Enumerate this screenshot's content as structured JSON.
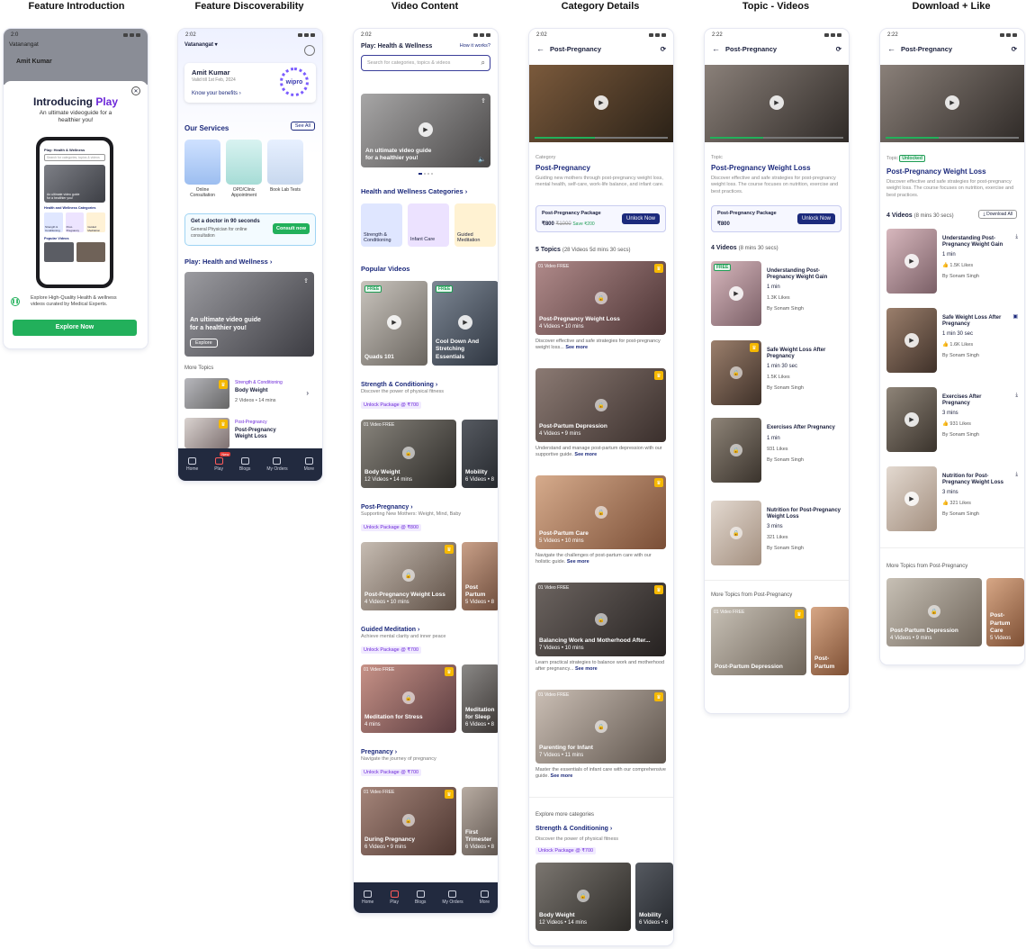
{
  "columns": [
    "Feature Introduction",
    "Feature Discoverability",
    "Video Content",
    "Category Details",
    "Topic - Videos",
    "Download + Like"
  ],
  "s1": {
    "time": "2:0",
    "location": "Vatanangat",
    "user": "Amit Kumar",
    "intro": "Introducing",
    "brand": "Play",
    "sub": "An ultimate videoguide for a healthier you!",
    "mock_header": "Play: Health & Wellness",
    "mock_search": "Search for categories, topics & videos",
    "mock_banner": "An ultimate video guide for a healthier you!",
    "mock_cat_title": "Health and Wellness Categories",
    "mock_cats": [
      "Strength & Conditioning",
      "Post-Pregnancy",
      "Guided Meditation"
    ],
    "mock_popular": "Popular Videos",
    "explore_text": "Explore High-Quality Health & wellness videos curated by Medical Experts.",
    "cta": "Explore Now"
  },
  "s2": {
    "time": "2:02",
    "location": "Vatanangat",
    "user": "Amit Kumar",
    "valid": "Valid till 1st Feb, 2024",
    "benefits": "Know your benefits",
    "partner": "wipro",
    "services_title": "Our Services",
    "see_all": "See All",
    "services": [
      "Online Consultation",
      "OPD/Clinic Appointment",
      "Book Lab Tests"
    ],
    "doctor_title": "Get a doctor in 90 seconds",
    "doctor_sub": "General Physician for online consultation",
    "consult": "Consult now",
    "play_title": "Play: Health and Wellness",
    "banner": "An ultimate video guide for a healthier you!",
    "explore": "Explore",
    "more_topics": "More Topics",
    "topics": [
      {
        "cat": "Strength & Conditioning",
        "name": "Body Weight",
        "meta": "2 Videos • 14 mins"
      },
      {
        "cat": "Post-Pregnancy",
        "name": "Post-Pregnancy Weight Loss",
        "meta": ""
      }
    ],
    "nav": [
      "Home",
      "Play",
      "Blogs",
      "My Orders",
      "More"
    ],
    "new": "New"
  },
  "s3": {
    "time": "2:02",
    "title": "Play: Health & Wellness",
    "how": "How it works?",
    "search": "Search for categories, topics & videos",
    "banner": "An ultimate video guide for a healthier you!",
    "cat_title": "Health and Wellness Categories",
    "cats": [
      "Strength & Conditioning",
      "Infant Care",
      "Guided Meditation"
    ],
    "popular": "Popular Videos",
    "free": "FREE",
    "popular_videos": [
      "Quads 101",
      "Cool Down And Stretching Essentials"
    ],
    "sections": [
      {
        "title": "Strength & Conditioning",
        "desc": "Discover the power of physical fitness",
        "pill": "Unlock Package @ ₹700",
        "cards": [
          {
            "name": "Body Weight",
            "meta": "12 Videos • 14 mins"
          },
          {
            "name": "Mobility",
            "meta": "6 Videos • 8"
          }
        ]
      },
      {
        "title": "Post-Pregnancy",
        "desc": "Supporting New Mothers: Weight, Mind, Baby",
        "pill": "Unlock Package @ ₹800",
        "cards": [
          {
            "name": "Post-Pregnancy Weight Loss",
            "meta": "4 Videos • 10 mins"
          },
          {
            "name": "Post Partum",
            "meta": "5 Videos • 8"
          }
        ]
      },
      {
        "title": "Guided Meditation",
        "desc": "Achieve mental clarity and inner peace",
        "pill": "Unlock Package @ ₹700",
        "cards": [
          {
            "name": "Meditation for Stress",
            "meta": "4 mins"
          },
          {
            "name": "Meditation for Sleep",
            "meta": "6 Videos • 8"
          }
        ]
      },
      {
        "title": "Pregnancy",
        "desc": "Navigate the journey of pregnancy",
        "pill": "Unlock Package @ ₹700",
        "cards": [
          {
            "name": "During Pregnancy",
            "meta": "6 Videos • 9 mins"
          },
          {
            "name": "First Trimester",
            "meta": "6 Videos • 8"
          }
        ]
      }
    ],
    "video_free": "01 Video FREE",
    "nav": [
      "Home",
      "Play",
      "Blogs",
      "My Orders",
      "More"
    ]
  },
  "s4": {
    "time": "2:02",
    "title": "Post-Pregnancy",
    "category_label": "Category",
    "category": "Post-Pregnancy",
    "desc": "Guiding new mothers through post-pregnancy weight loss, mental health, self-care, work-life balance, and infant care.",
    "pkg_title": "Post-Pregnancy Package",
    "pkg_price": "₹800",
    "pkg_old": "₹1000",
    "pkg_save": "Save ₹200",
    "unlock": "Unlock Now",
    "topics_count": "5 Topics",
    "topics_meta": "(28 Videos  5d mins 30 secs)",
    "video_free": "01 Video FREE",
    "see_more": "See more",
    "topics": [
      {
        "name": "Post-Pregnancy Weight Loss",
        "meta": "4 Videos • 10 mins",
        "desc": "Discover effective and safe strategies for post-pregnancy weight loss..."
      },
      {
        "name": "Post-Partum Depression",
        "meta": "4 Videos • 9 mins",
        "desc": "Understand and manage post-partum depression with our supportive guide."
      },
      {
        "name": "Post-Partum Care",
        "meta": "5 Videos • 10 mins",
        "desc": "Navigate the challenges of post-partum care with our holistic guide."
      },
      {
        "name": "Balancing Work and Motherhood After...",
        "meta": "7 Videos • 10 mins",
        "desc": "Learn practical strategies to balance work and motherhood after pregnancy..."
      },
      {
        "name": "Parenting for Infant",
        "meta": "7 Videos • 11 mins",
        "desc": "Master the essentials of infant care with our comprehensive guide."
      }
    ],
    "explore_more": "Explore more categories",
    "more_cat": "Strength & Conditioning",
    "more_desc": "Discover the power of physical fitness",
    "more_pill": "Unlock Package @ ₹700",
    "more_cards": [
      {
        "name": "Body Weight",
        "meta": "12 Videos • 14 mins"
      },
      {
        "name": "Mobility",
        "meta": "6 Videos • 8"
      }
    ]
  },
  "s5": {
    "time": "2:22",
    "title": "Post-Pregnancy",
    "topic_label": "Topic",
    "topic": "Post-Pregnancy Weight Loss",
    "desc": "Discover effective and safe strategies for post-pregnancy weight loss. The course focuses on nutrition, exercise and best practices.",
    "pkg_title": "Post-Pregnancy Package",
    "pkg_price": "₹800",
    "unlock": "Unlock Now",
    "videos_count": "4 Videos",
    "videos_meta": "(8 mins 30 secs)",
    "free": "FREE",
    "videos": [
      {
        "name": "Understanding Post-Pregnancy Weight Gain",
        "meta": "1 min",
        "likes": "1.3K Likes",
        "by": "By Sonam Singh"
      },
      {
        "name": "Safe Weight Loss After Pregnancy",
        "meta": "1 min 30 sec",
        "likes": "1.5K Likes",
        "by": "By Sonam Singh"
      },
      {
        "name": "Exercises After Pregnancy",
        "meta": "1 min",
        "likes": "931 Likes",
        "by": "By Sonam Singh"
      },
      {
        "name": "Nutrition for Post-Pregnancy Weight Loss",
        "meta": "3 mins",
        "likes": "321 Likes",
        "by": "By Sonam Singh"
      }
    ],
    "more": "More Topics from Post-Pregnancy",
    "more_cards": [
      "Post-Partum Depression",
      "Post-Partum"
    ],
    "video_free": "01 Video FREE"
  },
  "s6": {
    "time": "2:22",
    "title": "Post-Pregnancy",
    "topic_label": "Topic",
    "unlocked": "Unlocked",
    "topic": "Post-Pregnancy Weight Loss",
    "desc": "Discover effective and safe strategies for post-pregnancy weight loss. The course focuses on nutrition, exercise and best practices.",
    "videos_count": "4 Videos",
    "videos_meta": "(8 mins 30 secs)",
    "download": "Download All",
    "videos": [
      {
        "name": "Understanding Post-Pregnancy Weight Gain",
        "meta": "1 min",
        "likes": "1.5K Likes",
        "by": "By Sonam Singh"
      },
      {
        "name": "Safe Weight Loss After Pregnancy",
        "meta": "1 min 30 sec",
        "likes": "1.6K Likes",
        "by": "By Sonam Singh"
      },
      {
        "name": "Exercises After Pregnancy",
        "meta": "3 mins",
        "likes": "931 Likes",
        "by": "By Sonam Singh"
      },
      {
        "name": "Nutrition for Post-Pregnancy Weight Loss",
        "meta": "3 mins",
        "likes": "321 Likes",
        "by": "By Sonam Singh"
      }
    ],
    "more": "More Topics from Post-Pregnancy",
    "more_cards": [
      {
        "name": "Post-Partum Depression",
        "meta": "4 Videos • 9 mins"
      },
      {
        "name": "Post-Partum Care",
        "meta": "5 Videos"
      }
    ]
  }
}
